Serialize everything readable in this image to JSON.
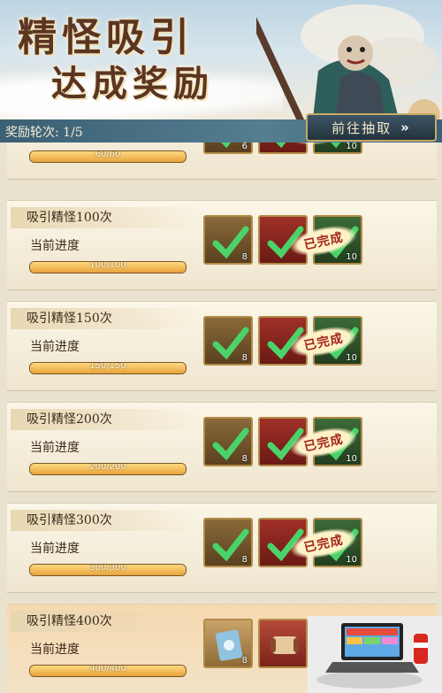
{
  "banner": {
    "title_line1": "精怪吸引",
    "title_line2": "达成奖励"
  },
  "round": {
    "label": "奖励轮次:",
    "value": "1/5"
  },
  "goto_button": {
    "label": "前往抽取"
  },
  "progress_label": "当前进度",
  "done_label": "已完成",
  "top_card": {
    "progress_text": "60/60",
    "progress_fraction": 1,
    "counts": [
      "6",
      "",
      "10"
    ]
  },
  "cards": [
    {
      "title": "吸引精怪100次",
      "progress_text": "100/100",
      "progress_fraction": 1,
      "counts": [
        "8",
        "",
        "10"
      ],
      "completed": true
    },
    {
      "title": "吸引精怪150次",
      "progress_text": "150/150",
      "progress_fraction": 1,
      "counts": [
        "8",
        "",
        "10"
      ],
      "completed": true
    },
    {
      "title": "吸引精怪200次",
      "progress_text": "200/200",
      "progress_fraction": 1,
      "counts": [
        "8",
        "",
        "10"
      ],
      "completed": true
    },
    {
      "title": "吸引精怪300次",
      "progress_text": "300/300",
      "progress_fraction": 1,
      "counts": [
        "8",
        "",
        "10"
      ],
      "completed": true
    },
    {
      "title": "吸引精怪400次",
      "progress_text": "400/400",
      "progress_fraction": 1,
      "counts": [
        "8",
        "",
        ""
      ],
      "completed": false
    }
  ],
  "icons": {
    "goto": "chevron-double-right-icon",
    "check": "checkmark-icon"
  },
  "colors": {
    "accent_gold": "#e7a43c",
    "bar_blue": "#3b5f74",
    "stamp_red": "#a3261d"
  }
}
